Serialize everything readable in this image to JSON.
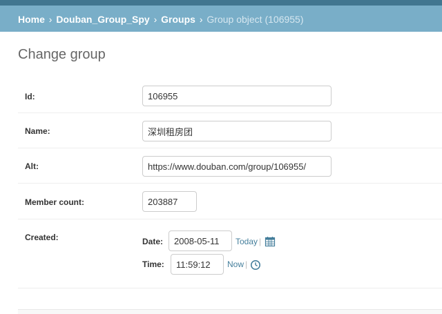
{
  "breadcrumbs": {
    "home": "Home",
    "app": "Douban_Group_Spy",
    "model": "Groups",
    "current": "Group object (106955)",
    "separator": "›"
  },
  "page": {
    "title": "Change group"
  },
  "form": {
    "id": {
      "label": "Id:",
      "value": "106955"
    },
    "name": {
      "label": "Name:",
      "value": "深圳租房团"
    },
    "alt": {
      "label": "Alt:",
      "value": "https://www.douban.com/group/106955/"
    },
    "member_count": {
      "label": "Member count:",
      "value": "203887"
    },
    "created": {
      "label": "Created:",
      "date_label": "Date:",
      "date_value": "2008-05-11",
      "date_shortcut": "Today",
      "time_label": "Time:",
      "time_value": "11:59:12",
      "time_shortcut": "Now",
      "pipe": "|",
      "calendar_icon": "calendar-icon",
      "clock_icon": "clock-icon"
    }
  },
  "colors": {
    "header_dark": "#417690",
    "breadcrumb_bg": "#79aec8",
    "link": "#447e9b"
  }
}
